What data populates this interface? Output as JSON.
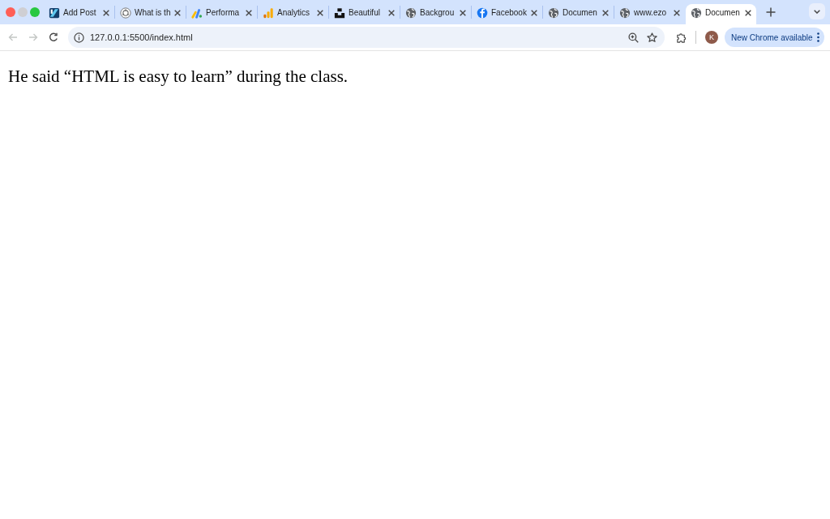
{
  "window_buttons": [
    {
      "kind": "close",
      "disabled": false
    },
    {
      "kind": "minimize",
      "disabled": true
    },
    {
      "kind": "zoom",
      "disabled": false
    }
  ],
  "tabs": [
    {
      "kind": "logo-square",
      "title": "Add Post",
      "selected": false
    },
    {
      "kind": "logo-circle",
      "title": "What is th",
      "selected": false
    },
    {
      "kind": "bars-multicolor",
      "title": "Performa",
      "selected": false
    },
    {
      "kind": "bars-orange",
      "title": "Analytics",
      "selected": false
    },
    {
      "kind": "blocks",
      "title": "Beautiful",
      "selected": false
    },
    {
      "kind": "globe",
      "title": "Backgrou",
      "selected": false
    },
    {
      "kind": "logo-f",
      "title": "Facebook",
      "selected": false
    },
    {
      "kind": "globe",
      "title": "Documen",
      "selected": false
    },
    {
      "kind": "globe",
      "title": "www.ezo",
      "selected": false
    },
    {
      "kind": "globe",
      "title": "Documen",
      "selected": true
    }
  ],
  "toolbar": {
    "back": {
      "disabled": true
    },
    "forward": {
      "disabled": true
    },
    "address": "127.0.0.1:5500/index.html",
    "profile_initial": "K",
    "update_button": "New Chrome available"
  },
  "page": {
    "paragraph": "He said “HTML is easy to learn” during the class."
  }
}
